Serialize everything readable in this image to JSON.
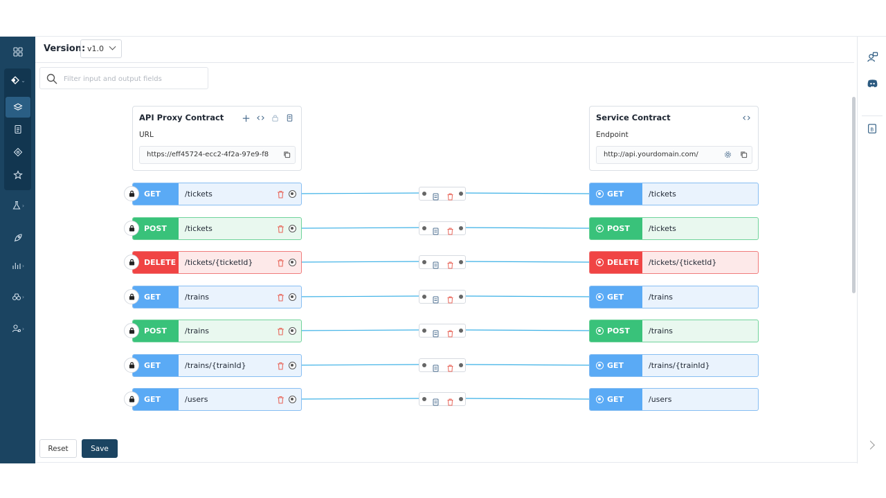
{
  "header": {
    "version_label": "Version:",
    "version_value": "v1.0"
  },
  "search": {
    "placeholder": "Filter input and output fields"
  },
  "proxy_contract": {
    "title": "API Proxy Contract",
    "field_label": "URL",
    "field_value": "https://eff45724-ecc2-4f2a-97e9-f8"
  },
  "service_contract": {
    "title": "Service Contract",
    "field_label": "Endpoint",
    "field_value": "http://api.yourdomain.com/"
  },
  "endpoints": [
    {
      "method": "GET",
      "path": "/tickets"
    },
    {
      "method": "POST",
      "path": "/tickets"
    },
    {
      "method": "DELETE",
      "path": "/tickets/{ticketId}"
    },
    {
      "method": "GET",
      "path": "/trains"
    },
    {
      "method": "POST",
      "path": "/trains"
    },
    {
      "method": "GET",
      "path": "/trains/{trainId}"
    },
    {
      "method": "GET",
      "path": "/users"
    }
  ],
  "actions": {
    "reset_label": "Reset",
    "save_label": "Save"
  },
  "colors": {
    "nav_bg": "#1b4461",
    "get": "#5aaaf5",
    "post": "#39c27a",
    "delete": "#f04444",
    "connector": "#3ab0e6"
  }
}
